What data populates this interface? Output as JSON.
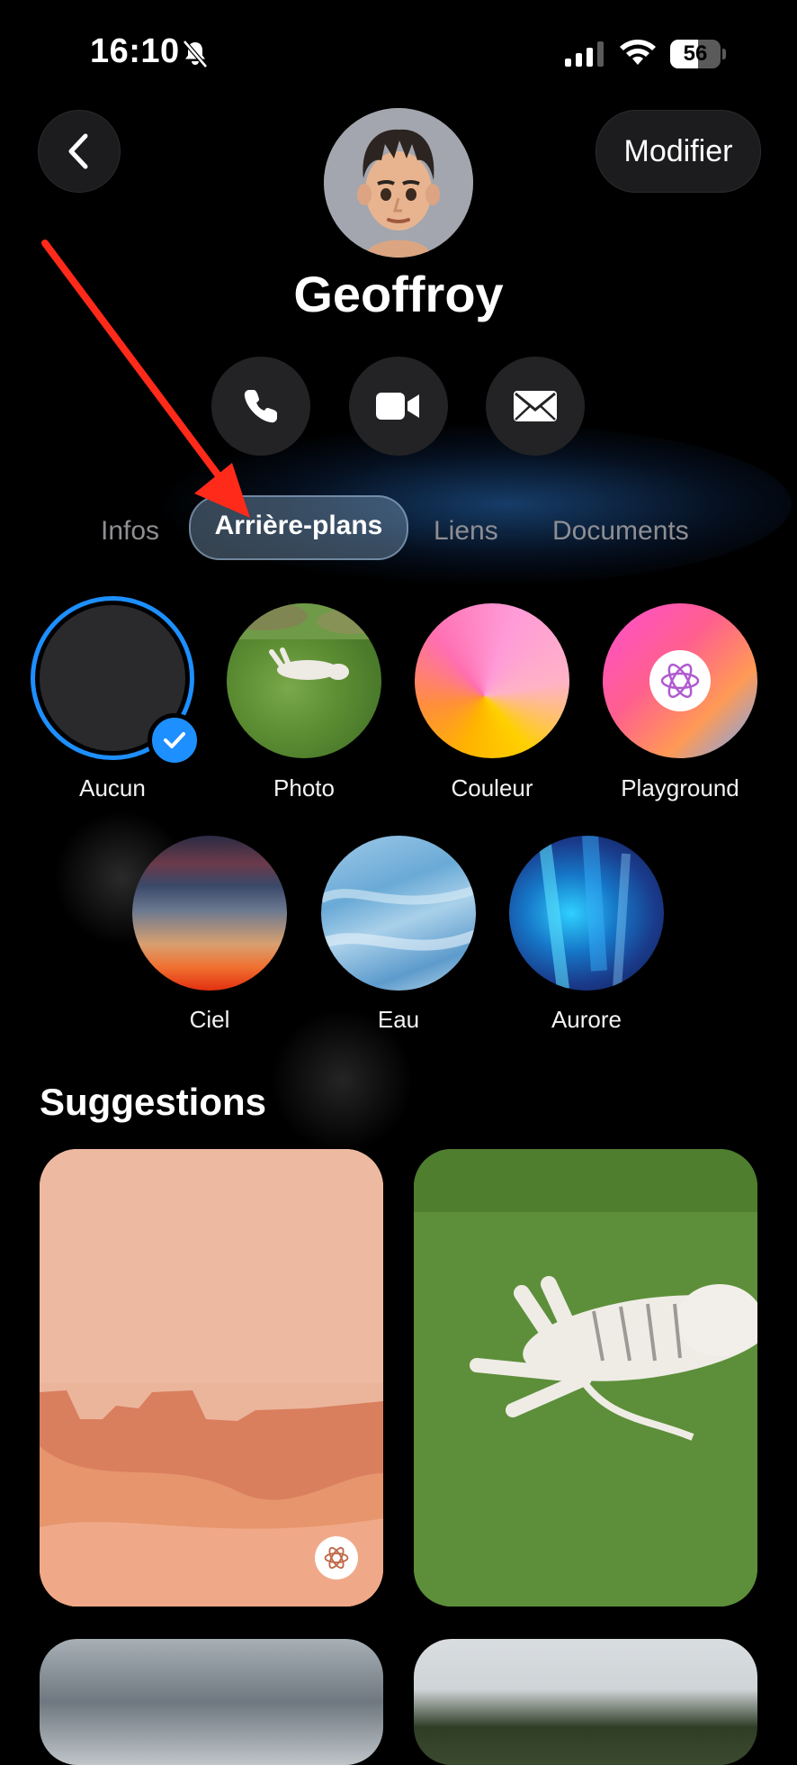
{
  "status_bar": {
    "time": "16:10",
    "battery": "56",
    "battery_level": 0.56
  },
  "header": {
    "edit_label": "Modifier",
    "contact_name": "Geoffroy"
  },
  "actions": {
    "call_icon": "phone-icon",
    "video_icon": "video-camera-icon",
    "mail_icon": "envelope-icon"
  },
  "tabs": [
    {
      "label": "Infos",
      "selected": false
    },
    {
      "label": "Arrière-plans",
      "selected": true
    },
    {
      "label": "Liens",
      "selected": false
    },
    {
      "label": "Documents",
      "selected": false
    }
  ],
  "backgrounds": [
    {
      "label": "Aucun",
      "selected": true
    },
    {
      "label": "Photo"
    },
    {
      "label": "Couleur"
    },
    {
      "label": "Playground"
    },
    {
      "label": "Ciel"
    },
    {
      "label": "Eau"
    },
    {
      "label": "Aurore"
    }
  ],
  "suggestions": {
    "title": "Suggestions"
  },
  "colors": {
    "accent": "#1d8fff",
    "annotation_arrow": "#ff2a1a"
  }
}
